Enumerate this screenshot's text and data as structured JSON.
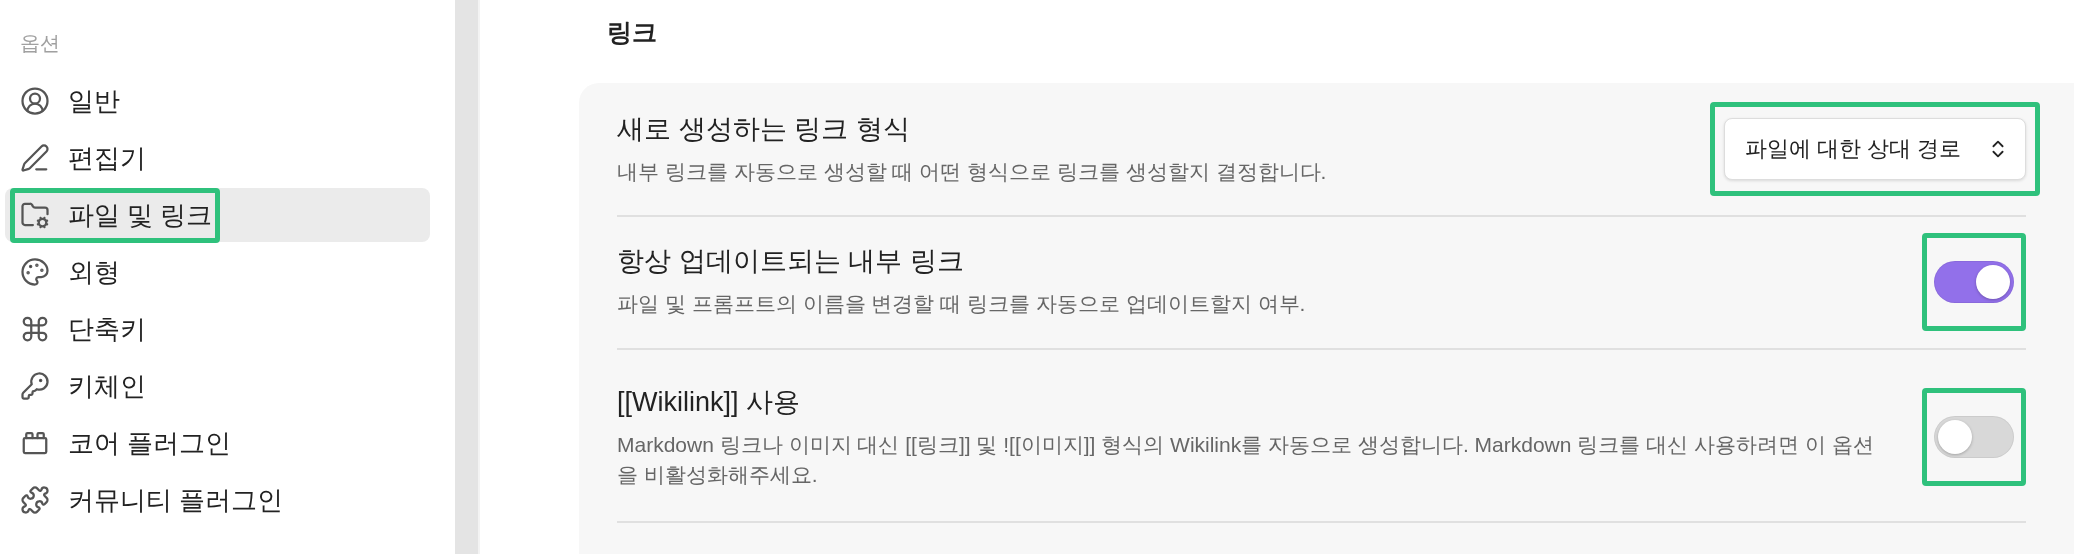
{
  "sidebar": {
    "heading": "옵션",
    "items": [
      {
        "label": "일반",
        "selected": false,
        "highlighted": false
      },
      {
        "label": "편집기",
        "selected": false,
        "highlighted": false
      },
      {
        "label": "파일 및 링크",
        "selected": true,
        "highlighted": true
      },
      {
        "label": "외형",
        "selected": false,
        "highlighted": false
      },
      {
        "label": "단축키",
        "selected": false,
        "highlighted": false
      },
      {
        "label": "키체인",
        "selected": false,
        "highlighted": false
      },
      {
        "label": "코어 플러그인",
        "selected": false,
        "highlighted": false
      },
      {
        "label": "커뮤니티 플러그인",
        "selected": false,
        "highlighted": false
      }
    ]
  },
  "section": {
    "title": "링크",
    "settings": [
      {
        "kind": "dropdown",
        "name": "새로 생성하는 링크 형식",
        "description": "내부 링크를 자동으로 생성할 때 어떤 형식으로 링크를 생성할지 결정합니다.",
        "value": "파일에 대한 상대 경로",
        "highlighted": true
      },
      {
        "kind": "toggle",
        "name": "항상 업데이트되는 내부 링크",
        "description": "파일 및 프롬프트의 이름을 변경할 때 링크를 자동으로 업데이트할지 여부.",
        "on": true,
        "highlighted": true
      },
      {
        "kind": "toggle",
        "name": "[[Wikilink]] 사용",
        "description": "Markdown 링크나 이미지 대신 [[링크]] 및 ![[이미지]] 형식의 Wikilink를 자동으로 생성합니다. Markdown 링크를 대신 사용하려면 이 옵션을 비활성화해주세요.",
        "on": false,
        "highlighted": true
      }
    ]
  }
}
